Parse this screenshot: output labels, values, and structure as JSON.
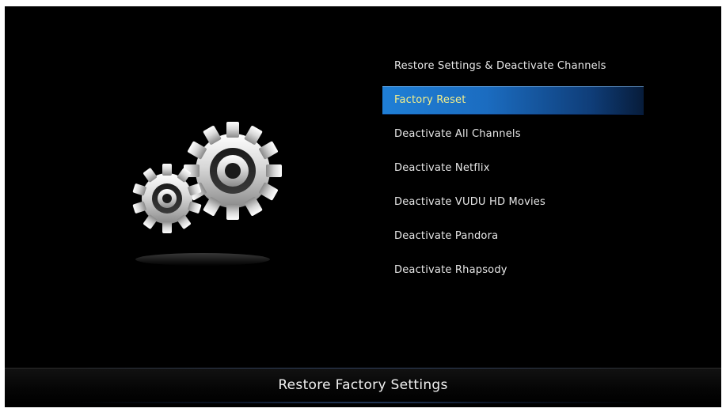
{
  "menu": {
    "items": [
      {
        "label": "Restore Settings & Deactivate Channels",
        "selected": false
      },
      {
        "label": "Factory Reset",
        "selected": true
      },
      {
        "label": "Deactivate All Channels",
        "selected": false
      },
      {
        "label": "Deactivate Netflix",
        "selected": false
      },
      {
        "label": "Deactivate VUDU HD Movies",
        "selected": false
      },
      {
        "label": "Deactivate Pandora",
        "selected": false
      },
      {
        "label": "Deactivate Rhapsody",
        "selected": false
      }
    ]
  },
  "footer": {
    "title": "Restore Factory Settings"
  },
  "illustration": {
    "icon": "gears-icon"
  },
  "colors": {
    "background": "#000000",
    "selected_highlight": "#1f7fd6",
    "selected_text": "#f5f08a",
    "menu_text": "#e8e8e8"
  }
}
